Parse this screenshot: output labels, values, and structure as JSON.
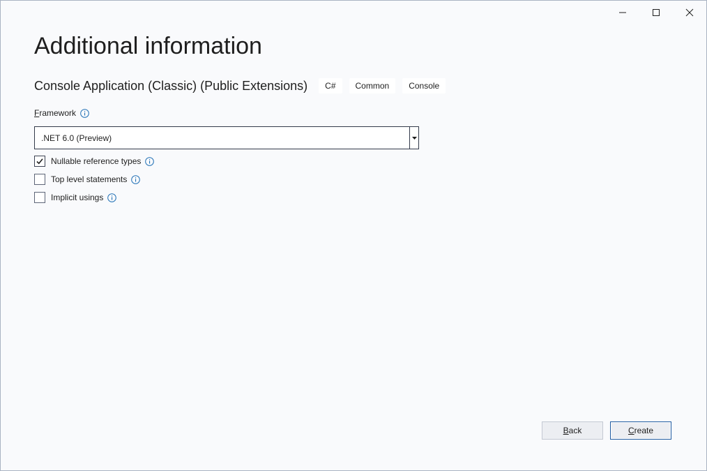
{
  "window": {
    "controls": [
      "minimize-icon",
      "maximize-icon",
      "close-icon"
    ]
  },
  "page": {
    "title": "Additional information",
    "template_name": "Console Application (Classic) (Public Extensions)",
    "tags": [
      "C#",
      "Common",
      "Console"
    ]
  },
  "framework": {
    "label_accel": "F",
    "label_rest": "ramework",
    "selected_value": ".NET 6.0 (Preview)",
    "info_icon": "info-icon"
  },
  "options": [
    {
      "label": "Nullable reference types",
      "checked": true
    },
    {
      "label": "Top level statements",
      "checked": false
    },
    {
      "label": "Implicit usings",
      "checked": false
    }
  ],
  "buttons": {
    "back_accel": "B",
    "back_rest": "ack",
    "create_accel": "C",
    "create_rest": "reate"
  },
  "colors": {
    "background": "#f9fafc",
    "info_icon": "#1f6fb5",
    "primary_border": "#1e5aa0"
  }
}
